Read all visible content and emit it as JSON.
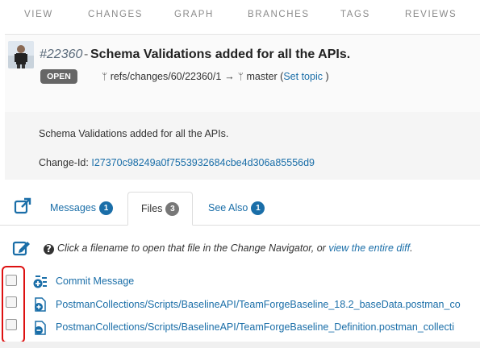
{
  "nav": {
    "items": [
      "VIEW",
      "CHANGES",
      "GRAPH",
      "BRANCHES",
      "TAGS",
      "REVIEWS"
    ]
  },
  "change": {
    "number": "#22360",
    "dash": "-",
    "title": "Schema Validations added for all the APIs.",
    "status": "OPEN",
    "ref": "refs/changes/60/22360/1",
    "target_branch": "master",
    "topic_open": "(",
    "set_topic": "Set topic",
    "topic_close": ")",
    "message": "Schema Validations added for all the APIs.",
    "change_id_label": "Change-Id:",
    "change_id": "I27370c98249a0f7553932684cbe4d306a85556d9"
  },
  "tabs": [
    {
      "label": "Messages",
      "count": "1"
    },
    {
      "label": "Files",
      "count": "3"
    },
    {
      "label": "See Also",
      "count": "1"
    }
  ],
  "files": {
    "help_prefix": "Click a filename to open that file in the Change Navigator, or",
    "help_link": "view the entire diff",
    "help_suffix": ".",
    "items": [
      {
        "name": "Commit Message",
        "icon": "commit-message-icon"
      },
      {
        "name": "PostmanCollections/Scripts/BaselineAPI/TeamForgeBaseline_18.2_baseData.postman_co",
        "icon": "file-added-icon"
      },
      {
        "name": "PostmanCollections/Scripts/BaselineAPI/TeamForgeBaseline_Definition.postman_collecti",
        "icon": "file-removed-icon"
      }
    ]
  },
  "colors": {
    "link": "#1a6ea8",
    "status_badge": "#666666",
    "highlight_box": "#dd1111"
  }
}
